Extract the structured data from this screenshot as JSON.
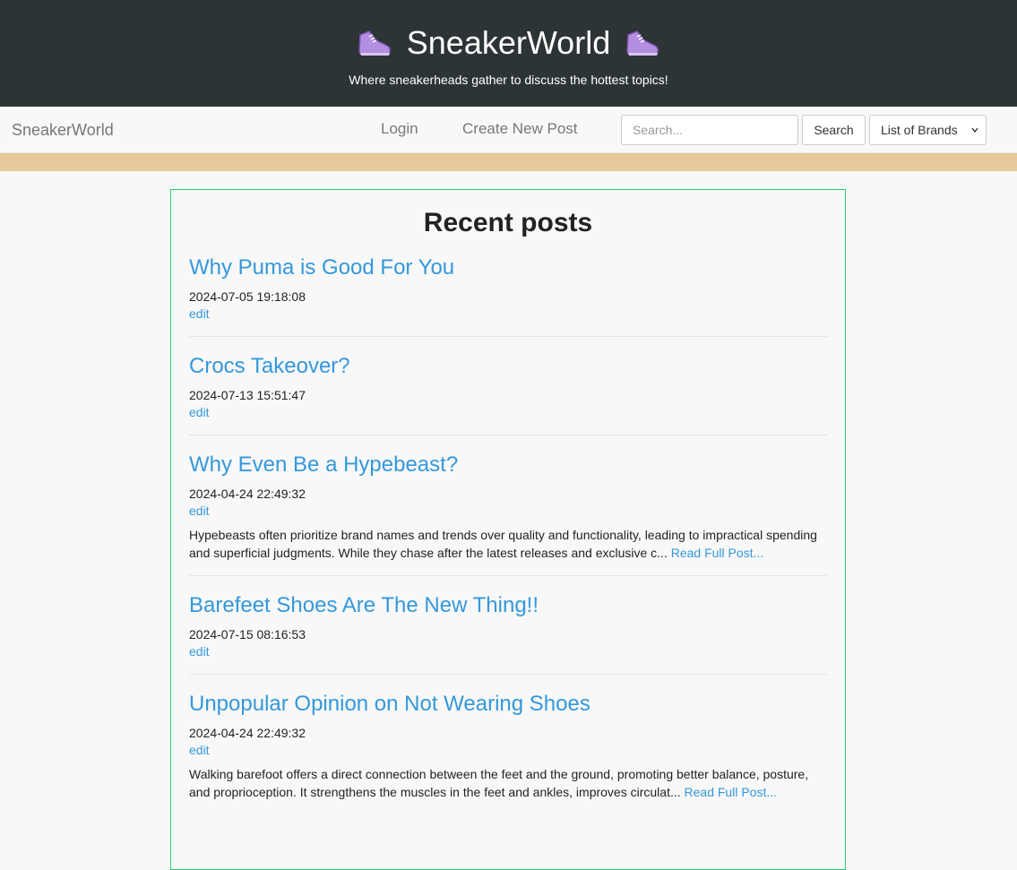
{
  "banner": {
    "title": "SneakerWorld",
    "subtitle": "Where sneakerheads gather to discuss the hottest topics!",
    "icon": "sneaker-icon"
  },
  "navbar": {
    "brand": "SneakerWorld",
    "login": "Login",
    "create_post": "Create New Post",
    "search_placeholder": "Search...",
    "search_button": "Search",
    "brands_select": "List of Brands"
  },
  "main": {
    "heading": "Recent posts",
    "posts": [
      {
        "title": "Why Puma is Good For You",
        "date": "2024-07-05 19:18:08",
        "edit": "edit",
        "excerpt": "",
        "read_more": ""
      },
      {
        "title": "Crocs Takeover?",
        "date": "2024-07-13 15:51:47",
        "edit": "edit",
        "excerpt": "",
        "read_more": ""
      },
      {
        "title": "Why Even Be a Hypebeast?",
        "date": "2024-04-24 22:49:32",
        "edit": "edit",
        "excerpt": "Hypebeasts often prioritize brand names and trends over quality and functionality, leading to impractical spending and superficial judgments. While they chase after the latest releases and exclusive c...",
        "read_more": "Read Full Post..."
      },
      {
        "title": "Barefeet Shoes Are The New Thing!!",
        "date": "2024-07-15 08:16:53",
        "edit": "edit",
        "excerpt": "",
        "read_more": ""
      },
      {
        "title": "Unpopular Opinion on Not Wearing Shoes",
        "date": "2024-04-24 22:49:32",
        "edit": "edit",
        "excerpt": "Walking barefoot offers a direct connection between the feet and the ground, promoting better balance, posture, and proprioception. It strengthens the muscles in the feet and ankles, improves circulat...",
        "read_more": "Read Full Post..."
      }
    ]
  },
  "colors": {
    "banner_bg": "#2d3436",
    "accent_bar": "#e8c99b",
    "link": "#3498db",
    "panel_border": "#2ecc71"
  }
}
